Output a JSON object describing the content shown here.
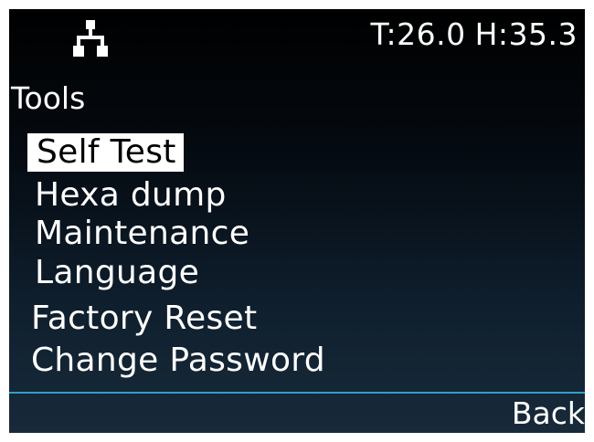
{
  "status_bar": {
    "icon": "network-icon",
    "temperature": "T:26.0",
    "humidity": "H:35.3"
  },
  "page": {
    "title": "Tools"
  },
  "menu": {
    "items": [
      {
        "label": "Self Test",
        "selected": true
      },
      {
        "label": "Hexa dump",
        "selected": false
      },
      {
        "label": "Maintenance",
        "selected": false
      },
      {
        "label": "Language",
        "selected": false
      },
      {
        "label": "Factory Reset",
        "selected": false
      },
      {
        "label": "Change Password",
        "selected": false
      }
    ]
  },
  "softkeys": {
    "right_label": "Back"
  },
  "colors": {
    "background": "#000000",
    "background_bottom": "#182a3a",
    "text": "#ffffff",
    "selection_background": "#ffffff",
    "selection_text": "#000000",
    "divider": "#2f9fc8"
  }
}
